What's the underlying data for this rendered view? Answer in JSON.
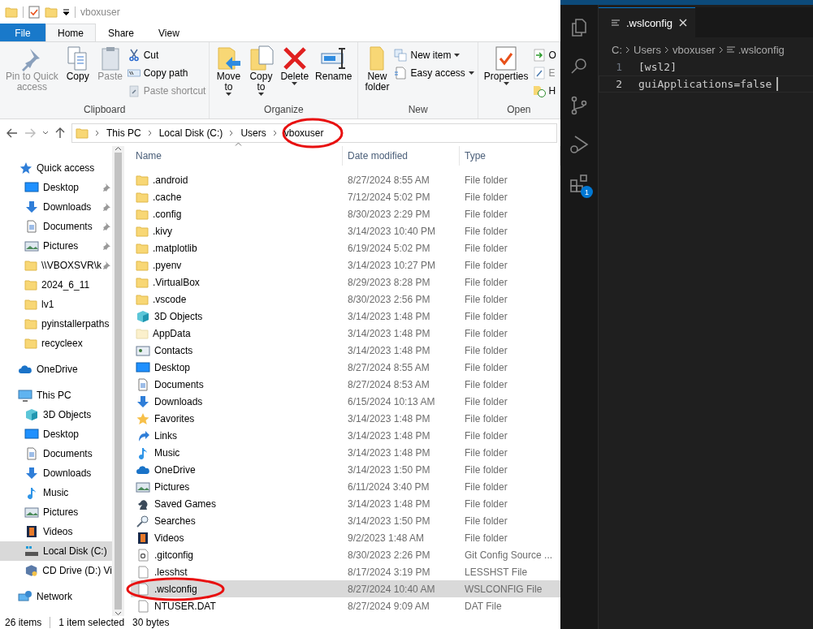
{
  "title_bar": {
    "title": "vboxuser"
  },
  "ribbon_tabs": [
    {
      "label": "File",
      "kind": "file",
      "selected": false
    },
    {
      "label": "Home",
      "kind": "tab",
      "selected": true
    },
    {
      "label": "Share",
      "kind": "tab",
      "selected": false
    },
    {
      "label": "View",
      "kind": "tab",
      "selected": false
    }
  ],
  "ribbon_groups": [
    {
      "label": "Clipboard",
      "large_buttons": [
        {
          "label": "Pin to Quick\naccess",
          "kind": "pin",
          "disabled": true,
          "dropdown": false
        },
        {
          "label": "Copy",
          "kind": "copy",
          "disabled": false,
          "dropdown": false
        },
        {
          "label": "Paste",
          "kind": "paste",
          "disabled": true,
          "dropdown": false
        }
      ],
      "small_buttons": [
        {
          "label": "Cut",
          "kind": "cut",
          "disabled": false,
          "dropdown": false
        },
        {
          "label": "Copy path",
          "kind": "copy-path",
          "disabled": false,
          "dropdown": false
        },
        {
          "label": "Paste shortcut",
          "kind": "paste-shortcut",
          "disabled": true,
          "dropdown": false
        }
      ]
    },
    {
      "label": "Organize",
      "large_buttons": [
        {
          "label": "Move\nto",
          "kind": "move",
          "disabled": false,
          "dropdown": true
        },
        {
          "label": "Copy\nto",
          "kind": "copy-to",
          "disabled": false,
          "dropdown": true
        },
        {
          "label": "Delete",
          "kind": "delete",
          "disabled": false,
          "dropdown": true
        },
        {
          "label": "Rename",
          "kind": "rename",
          "disabled": false,
          "dropdown": false
        }
      ]
    },
    {
      "label": "New",
      "large_buttons": [
        {
          "label": "New\nfolder",
          "kind": "folder",
          "disabled": false,
          "dropdown": false
        }
      ],
      "small_buttons": [
        {
          "label": "New item",
          "kind": "new-item",
          "disabled": false,
          "dropdown": true
        },
        {
          "label": "Easy access",
          "kind": "easy-access",
          "disabled": false,
          "dropdown": true
        }
      ]
    },
    {
      "label": "Open",
      "large_buttons": [
        {
          "label": "Properties",
          "kind": "properties",
          "disabled": false,
          "dropdown": true
        }
      ],
      "small_buttons": [
        {
          "label": "O",
          "kind": "open",
          "disabled": false,
          "dropdown": false
        },
        {
          "label": "E",
          "kind": "edit",
          "disabled": true,
          "dropdown": false
        },
        {
          "label": "H",
          "kind": "history",
          "disabled": false,
          "dropdown": false
        }
      ]
    }
  ],
  "address_bar": {
    "crumbs": [
      "This PC",
      "Local Disk (C:)",
      "Users",
      "vboxuser"
    ]
  },
  "navigation": [
    {
      "label": "Quick access",
      "kind": "quick-access",
      "selected": false,
      "children": [
        {
          "label": "Desktop",
          "kind": "desktop",
          "selected": false,
          "pinned": true
        },
        {
          "label": "Downloads",
          "kind": "download",
          "selected": false,
          "pinned": true
        },
        {
          "label": "Documents",
          "kind": "document",
          "selected": false,
          "pinned": true
        },
        {
          "label": "Pictures",
          "kind": "pictures",
          "selected": false,
          "pinned": true
        },
        {
          "label": "\\\\VBOXSVR\\k",
          "kind": "network-folder",
          "selected": false,
          "pinned": true
        },
        {
          "label": "2024_6_11",
          "kind": "folder",
          "selected": false,
          "pinned": false
        },
        {
          "label": "lv1",
          "kind": "folder",
          "selected": false,
          "pinned": false
        },
        {
          "label": "pyinstallerpaths",
          "kind": "folder",
          "selected": false,
          "pinned": false
        },
        {
          "label": "recycleex",
          "kind": "folder",
          "selected": false,
          "pinned": false
        }
      ]
    },
    {
      "label": "OneDrive",
      "kind": "cloud",
      "selected": false
    },
    {
      "label": "This PC",
      "kind": "pc",
      "selected": false,
      "children": [
        {
          "label": "3D Objects",
          "kind": "cube",
          "selected": false,
          "pinned": false
        },
        {
          "label": "Desktop",
          "kind": "desktop",
          "selected": false,
          "pinned": false
        },
        {
          "label": "Documents",
          "kind": "document",
          "selected": false,
          "pinned": false
        },
        {
          "label": "Downloads",
          "kind": "download",
          "selected": false,
          "pinned": false
        },
        {
          "label": "Music",
          "kind": "music",
          "selected": false,
          "pinned": false
        },
        {
          "label": "Pictures",
          "kind": "pictures",
          "selected": false,
          "pinned": false
        },
        {
          "label": "Videos",
          "kind": "video",
          "selected": false,
          "pinned": false
        },
        {
          "label": "Local Disk (C:)",
          "kind": "disk",
          "selected": true,
          "pinned": false
        },
        {
          "label": "CD Drive (D:) Vi",
          "kind": "cd",
          "selected": false,
          "pinned": false
        }
      ]
    },
    {
      "label": "Network",
      "kind": "network",
      "selected": false
    }
  ],
  "file_list": {
    "columns": [
      "Name",
      "Date modified",
      "Type"
    ],
    "rows": [
      {
        "name": ".android",
        "date": "8/27/2024 8:55 AM",
        "type": "File folder",
        "kind": "folder",
        "selected": false
      },
      {
        "name": ".cache",
        "date": "7/12/2024 5:02 PM",
        "type": "File folder",
        "kind": "folder",
        "selected": false
      },
      {
        "name": ".config",
        "date": "8/30/2023 2:29 PM",
        "type": "File folder",
        "kind": "folder",
        "selected": false
      },
      {
        "name": ".kivy",
        "date": "3/14/2023 10:40 PM",
        "type": "File folder",
        "kind": "folder",
        "selected": false
      },
      {
        "name": ".matplotlib",
        "date": "6/19/2024 5:02 PM",
        "type": "File folder",
        "kind": "folder",
        "selected": false
      },
      {
        "name": ".pyenv",
        "date": "3/14/2023 10:27 PM",
        "type": "File folder",
        "kind": "folder",
        "selected": false
      },
      {
        "name": ".VirtualBox",
        "date": "8/29/2023 8:28 PM",
        "type": "File folder",
        "kind": "folder",
        "selected": false
      },
      {
        "name": ".vscode",
        "date": "8/30/2023 2:56 PM",
        "type": "File folder",
        "kind": "folder",
        "selected": false
      },
      {
        "name": "3D Objects",
        "date": "3/14/2023 1:48 PM",
        "type": "File folder",
        "kind": "cube",
        "selected": false
      },
      {
        "name": "AppData",
        "date": "3/14/2023 1:48 PM",
        "type": "File folder",
        "kind": "folder-hidden",
        "selected": false
      },
      {
        "name": "Contacts",
        "date": "3/14/2023 1:48 PM",
        "type": "File folder",
        "kind": "contacts",
        "selected": false
      },
      {
        "name": "Desktop",
        "date": "8/27/2024 8:55 AM",
        "type": "File folder",
        "kind": "desktop",
        "selected": false
      },
      {
        "name": "Documents",
        "date": "8/27/2024 8:53 AM",
        "type": "File folder",
        "kind": "document",
        "selected": false
      },
      {
        "name": "Downloads",
        "date": "6/15/2024 10:13 AM",
        "type": "File folder",
        "kind": "download",
        "selected": false
      },
      {
        "name": "Favorites",
        "date": "3/14/2023 1:48 PM",
        "type": "File folder",
        "kind": "star",
        "selected": false
      },
      {
        "name": "Links",
        "date": "3/14/2023 1:48 PM",
        "type": "File folder",
        "kind": "link",
        "selected": false
      },
      {
        "name": "Music",
        "date": "3/14/2023 1:48 PM",
        "type": "File folder",
        "kind": "music",
        "selected": false
      },
      {
        "name": "OneDrive",
        "date": "3/14/2023 1:50 PM",
        "type": "File folder",
        "kind": "cloud",
        "selected": false
      },
      {
        "name": "Pictures",
        "date": "6/11/2024 3:40 PM",
        "type": "File folder",
        "kind": "pictures",
        "selected": false
      },
      {
        "name": "Saved Games",
        "date": "3/14/2023 1:48 PM",
        "type": "File folder",
        "kind": "game",
        "selected": false
      },
      {
        "name": "Searches",
        "date": "3/14/2023 1:50 PM",
        "type": "File folder",
        "kind": "search",
        "selected": false
      },
      {
        "name": "Videos",
        "date": "9/2/2023 1:48 AM",
        "type": "File folder",
        "kind": "video",
        "selected": false
      },
      {
        "name": ".gitconfig",
        "date": "8/30/2023 2:26 PM",
        "type": "Git Config Source ...",
        "kind": "gear-file",
        "selected": false
      },
      {
        "name": ".lesshst",
        "date": "8/17/2024 3:19 PM",
        "type": "LESSHST File",
        "kind": "file",
        "selected": false
      },
      {
        "name": ".wslconfig",
        "date": "8/27/2024 10:40 AM",
        "type": "WSLCONFIG File",
        "kind": "file",
        "selected": true
      },
      {
        "name": "NTUSER.DAT",
        "date": "8/27/2024 9:09 AM",
        "type": "DAT File",
        "kind": "file",
        "selected": false
      }
    ]
  },
  "status_bar": {
    "item_count": "26 items",
    "selection": "1 item selected",
    "size": "30 bytes"
  },
  "editor": {
    "activity_bar": [
      {
        "kind": "explorer"
      },
      {
        "kind": "search"
      },
      {
        "kind": "source-control"
      },
      {
        "kind": "run-debug"
      },
      {
        "kind": "extensions",
        "badge": "1"
      }
    ],
    "tabs": [
      {
        "label": ".wslconfig",
        "selected": true
      }
    ],
    "breadcrumbs": [
      "C:",
      "Users",
      "vboxuser",
      ".wslconfig"
    ],
    "lines": [
      {
        "number": "1",
        "text": "[wsl2]",
        "current": false
      },
      {
        "number": "2",
        "text": "guiApplications=false",
        "current": true
      }
    ]
  }
}
